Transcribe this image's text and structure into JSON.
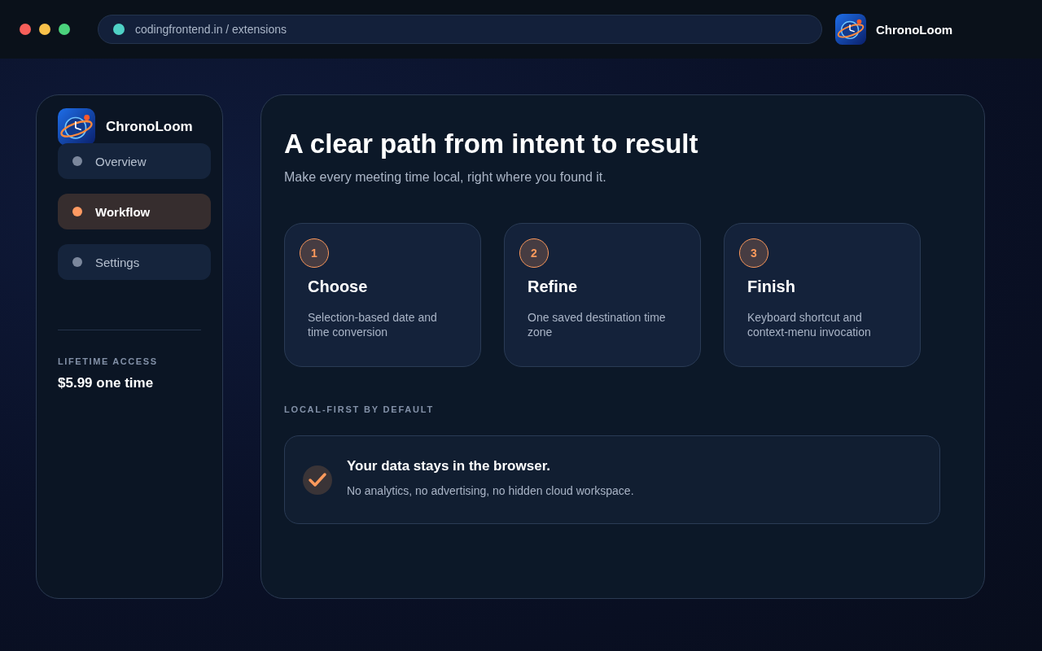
{
  "browser": {
    "address": "codingfrontend.in / extensions",
    "app_name": "ChronoLoom"
  },
  "sidebar": {
    "app_name": "ChronoLoom",
    "items": [
      {
        "label": "Overview",
        "selected": false
      },
      {
        "label": "Workflow",
        "selected": true
      },
      {
        "label": "Settings",
        "selected": false
      }
    ],
    "access_label": "LIFETIME ACCESS",
    "price": "$5.99 one time"
  },
  "main": {
    "title": "A clear path from intent to result",
    "subtitle": "Make every meeting time local, right where you found it.",
    "steps": [
      {
        "number": "1",
        "title": "Choose",
        "text": "Selection-based date and time conversion"
      },
      {
        "number": "2",
        "title": "Refine",
        "text": "One saved destination time zone"
      },
      {
        "number": "3",
        "title": "Finish",
        "text": "Keyboard shortcut and context-menu invocation"
      }
    ],
    "section_label": "LOCAL-FIRST BY DEFAULT",
    "notice": {
      "checked": true,
      "title": "Your data stays in the browser.",
      "text": "No analytics, no advertising, no hidden cloud workspace."
    }
  }
}
